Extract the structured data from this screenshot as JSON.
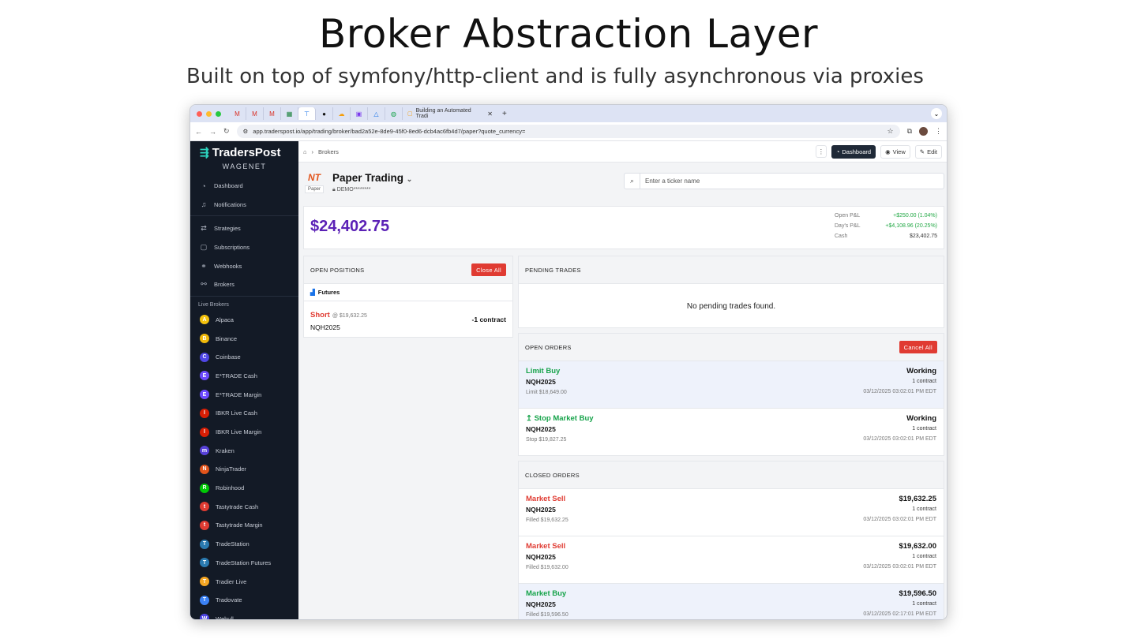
{
  "slide": {
    "title": "Broker Abstraction Layer",
    "subtitle": "Built on top of symfony/http-client and is fully asynchronous via proxies"
  },
  "browser": {
    "active_tab_title": "Building an Automated Tradi",
    "url": "app.traderspost.io/app/trading/broker/bad2a52e-8de9-45f0-8ed6-dcb4ac6fb4d7/paper?quote_currency=",
    "new_tab": "+"
  },
  "sidebar": {
    "brand": "TradersPost",
    "workspace": "WAGENET",
    "nav": [
      {
        "label": "Dashboard",
        "icon": "gauge-icon",
        "glyph": "◔"
      },
      {
        "label": "Notifications",
        "icon": "bell-icon",
        "glyph": "♫"
      }
    ],
    "nav2": [
      {
        "label": "Strategies",
        "icon": "strategies-icon",
        "glyph": "⇄"
      },
      {
        "label": "Subscriptions",
        "icon": "subscriptions-icon",
        "glyph": "▢"
      },
      {
        "label": "Webhooks",
        "icon": "webhooks-icon",
        "glyph": "⚭"
      },
      {
        "label": "Brokers",
        "icon": "brokers-icon",
        "glyph": "⚯"
      }
    ],
    "live_brokers_label": "Live Brokers",
    "brokers": [
      {
        "label": "Alpaca",
        "color": "#f4c20d",
        "glyph": "A"
      },
      {
        "label": "Binance",
        "color": "#f0b90b",
        "glyph": "B"
      },
      {
        "label": "Coinbase",
        "color": "#4f46e5",
        "glyph": "C"
      },
      {
        "label": "E*TRADE Cash",
        "color": "#6d4aff",
        "glyph": "E"
      },
      {
        "label": "E*TRADE Margin",
        "color": "#6d4aff",
        "glyph": "E"
      },
      {
        "label": "IBKR Live Cash",
        "color": "#d81e05",
        "glyph": "I"
      },
      {
        "label": "IBKR Live Margin",
        "color": "#d81e05",
        "glyph": "I"
      },
      {
        "label": "Kraken",
        "color": "#5741d9",
        "glyph": "m"
      },
      {
        "label": "NinjaTrader",
        "color": "#e2541b",
        "glyph": "N"
      },
      {
        "label": "Robinhood",
        "color": "#00c805",
        "glyph": "R"
      },
      {
        "label": "Tastytrade Cash",
        "color": "#e03b32",
        "glyph": "t"
      },
      {
        "label": "Tastytrade Margin",
        "color": "#e03b32",
        "glyph": "t"
      },
      {
        "label": "TradeStation",
        "color": "#2a7ab0",
        "glyph": "T"
      },
      {
        "label": "TradeStation Futures",
        "color": "#2a7ab0",
        "glyph": "T"
      },
      {
        "label": "Tradier Live",
        "color": "#f5a623",
        "glyph": "T"
      },
      {
        "label": "Tradovate",
        "color": "#3b82f6",
        "glyph": "T"
      },
      {
        "label": "Webull",
        "color": "#4f46e5",
        "glyph": "W"
      }
    ]
  },
  "topbar": {
    "breadcrumb": "Brokers",
    "dashboard": "Dashboard",
    "view": "View",
    "edit": "Edit"
  },
  "account": {
    "name": "Paper Trading",
    "badge": "Paper",
    "id": "DEMO********",
    "search_placeholder": "Enter a ticker name",
    "balance": "$24,402.75",
    "stats": [
      {
        "label": "Open P&L",
        "value": "+$250.00 (1.04%)",
        "positive": true
      },
      {
        "label": "Day's P&L",
        "value": "+$4,108.96 (20.25%)",
        "positive": true
      },
      {
        "label": "Cash",
        "value": "$23,402.75",
        "positive": false
      }
    ]
  },
  "positions": {
    "title": "OPEN POSITIONS",
    "close_all": "Close All",
    "group": "Futures",
    "items": [
      {
        "side": "Short",
        "at": "@ $19,632.25",
        "symbol": "NQH2025",
        "qty": "-1 contract"
      }
    ]
  },
  "pending": {
    "title": "PENDING TRADES",
    "empty": "No pending trades found."
  },
  "open_orders": {
    "title": "OPEN ORDERS",
    "cancel_all": "Cancel All",
    "items": [
      {
        "type": "Limit Buy",
        "side": "buy",
        "symbol": "NQH2025",
        "detail": "Limit $18,649.00",
        "status": "Working",
        "qty": "1 contract",
        "time": "03/12/2025 03:02:01 PM EDT",
        "hl": true
      },
      {
        "type": "↥ Stop Market Buy",
        "side": "buy",
        "symbol": "NQH2025",
        "detail": "Stop $19,827.25",
        "status": "Working",
        "qty": "1 contract",
        "time": "03/12/2025 03:02:01 PM EDT",
        "hl": false
      }
    ]
  },
  "closed_orders": {
    "title": "CLOSED ORDERS",
    "items": [
      {
        "type": "Market Sell",
        "side": "sell",
        "symbol": "NQH2025",
        "detail": "Filled $19,632.25",
        "status": "$19,632.25",
        "qty": "1 contract",
        "time": "03/12/2025 03:02:01 PM EDT",
        "hl": false
      },
      {
        "type": "Market Sell",
        "side": "sell",
        "symbol": "NQH2025",
        "detail": "Filled $19,632.00",
        "status": "$19,632.00",
        "qty": "1 contract",
        "time": "03/12/2025 03:02:01 PM EDT",
        "hl": false
      },
      {
        "type": "Market Buy",
        "side": "buy",
        "symbol": "NQH2025",
        "detail": "Filled $19,596.50",
        "status": "$19,596.50",
        "qty": "1 contract",
        "time": "03/12/2025 02:17:01 PM EDT",
        "hl": true
      }
    ]
  }
}
